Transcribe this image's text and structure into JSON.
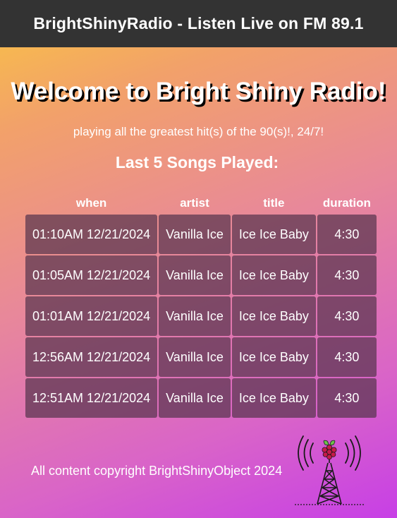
{
  "header": {
    "title": "BrightShinyRadio - Listen Live on FM 89.1"
  },
  "main": {
    "welcome": "Welcome to Bright Shiny Radio!",
    "tagline": "playing all the greatest hit(s) of the 90(s)!, 24/7!",
    "songs_heading": "Last 5 Songs Played:"
  },
  "table": {
    "headers": [
      "when",
      "artist",
      "title",
      "duration"
    ],
    "rows": [
      [
        "01:10AM 12/21/2024",
        "Vanilla Ice",
        "Ice Ice Baby",
        "4:30"
      ],
      [
        "01:05AM 12/21/2024",
        "Vanilla Ice",
        "Ice Ice Baby",
        "4:30"
      ],
      [
        "01:01AM 12/21/2024",
        "Vanilla Ice",
        "Ice Ice Baby",
        "4:30"
      ],
      [
        "12:56AM 12/21/2024",
        "Vanilla Ice",
        "Ice Ice Baby",
        "4:30"
      ],
      [
        "12:51AM 12/21/2024",
        "Vanilla Ice",
        "Ice Ice Baby",
        "4:30"
      ]
    ]
  },
  "footer": {
    "copyright": "All content copyright BrightShinyObject 2024",
    "logo_icon": "raspberry-pi-radio-tower-icon"
  },
  "colors": {
    "topbar": "#333333",
    "gradient_start": "#f9c443",
    "gradient_end": "#c73fe6",
    "cell_bg": "#58344e",
    "raspberry": "#c51a4a",
    "leaf": "#6cc04a"
  }
}
